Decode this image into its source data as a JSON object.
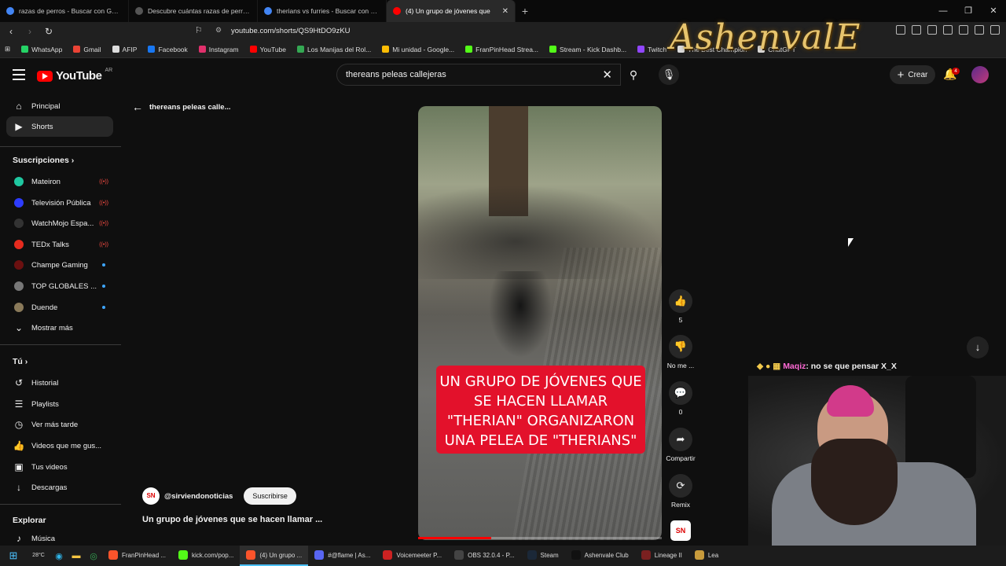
{
  "browser": {
    "tabs": [
      {
        "title": "razas de perros - Buscar con Google",
        "color": "#4285f4"
      },
      {
        "title": "Descubre cuántas razas de perros ex",
        "color": "#333333"
      },
      {
        "title": "therians vs furries - Buscar con Goog",
        "color": "#4285f4"
      },
      {
        "title": "(4) Un grupo de jóvenes que",
        "color": "#ff0000"
      }
    ],
    "active_tab_index": 3,
    "url": "youtube.com/shorts/QS9HtDO9zKU",
    "bookmarks": [
      {
        "label": "WhatsApp",
        "color": "#25d366"
      },
      {
        "label": "Gmail",
        "color": "#ea4335"
      },
      {
        "label": "AFIP",
        "color": "#dddddd"
      },
      {
        "label": "Facebook",
        "color": "#1877f2"
      },
      {
        "label": "Instagram",
        "color": "#e1306c"
      },
      {
        "label": "YouTube",
        "color": "#ff0000"
      },
      {
        "label": "Los Manijas del Rol...",
        "color": "#34a853"
      },
      {
        "label": "Mi unidad - Google...",
        "color": "#fbbc04"
      },
      {
        "label": "FranPinHead Strea...",
        "color": "#53fc18"
      },
      {
        "label": "Stream - Kick Dashb...",
        "color": "#53fc18"
      },
      {
        "label": "Twitch",
        "color": "#9146ff"
      },
      {
        "label": "The Best Champion",
        "color": "#dddddd"
      },
      {
        "label": "ChatGPT",
        "color": "#dddddd"
      }
    ]
  },
  "overlay": {
    "logo_text": "AshenvalE",
    "chat": {
      "badges": "◆ ● ▦",
      "user": "Maqiz",
      "message": ": no se que pensar X_X"
    }
  },
  "youtube": {
    "logo": "YouTube",
    "region": "AR",
    "search_value": "thereans peleas callejeras",
    "create_label": "Crear",
    "notifications": "4",
    "sidebar": {
      "main": [
        {
          "label": "Principal",
          "icon": "⌂"
        },
        {
          "label": "Shorts",
          "icon": "▶"
        }
      ],
      "subs_heading": "Suscripciones",
      "subs": [
        {
          "label": "Mateiron",
          "color": "#1fc7a0",
          "status": "live"
        },
        {
          "label": "Televisión Pública",
          "color": "#2d3cff",
          "status": "live"
        },
        {
          "label": "WatchMojo Espa...",
          "color": "#222222",
          "status": "live"
        },
        {
          "label": "TEDx Talks",
          "color": "#e62b1e",
          "status": "live"
        },
        {
          "label": "Champe Gaming",
          "color": "#6b1010",
          "status": "new"
        },
        {
          "label": "TOP GLOBALES ...",
          "color": "#777777",
          "status": "new"
        },
        {
          "label": "Duende",
          "color": "#8a7a5a",
          "status": "new"
        }
      ],
      "show_more": "Mostrar más",
      "you_heading": "Tú",
      "you": [
        {
          "label": "Historial",
          "icon": "↺"
        },
        {
          "label": "Playlists",
          "icon": "☰"
        },
        {
          "label": "Ver más tarde",
          "icon": "◷"
        },
        {
          "label": "Videos que me gus...",
          "icon": "👍"
        },
        {
          "label": "Tus videos",
          "icon": "▣"
        },
        {
          "label": "Descargas",
          "icon": "↓"
        }
      ],
      "explore_heading": "Explorar",
      "explore": [
        {
          "label": "Música",
          "icon": "♪"
        }
      ]
    },
    "short": {
      "back_label": "thereans peleas calle...",
      "caption": "UN GRUPO DE JÓVENES QUE SE HACEN LLAMAR \"THERIAN\" ORGANIZARON UNA PELEA DE \"THERIANS\"",
      "channel_logo": "SN",
      "channel": "@sirviendonoticias",
      "subscribe": "Suscribirse",
      "title": "Un grupo de jóvenes que se hacen llamar ...",
      "progress": 0.3,
      "likes": "5",
      "dislike_label": "No me ...",
      "comments": "0",
      "share_label": "Compartir",
      "remix_label": "Remix"
    }
  },
  "taskbar": {
    "weather": "28°C",
    "apps": [
      {
        "label": "FranPinHead ...",
        "color": "#fb542b",
        "active": false
      },
      {
        "label": "kick.com/pop...",
        "color": "#53fc18",
        "active": false
      },
      {
        "label": "(4) Un grupo ...",
        "color": "#fb542b",
        "active": true
      },
      {
        "label": "#@flame | As...",
        "color": "#5865f2",
        "active": false
      },
      {
        "label": "Voicemeeter P...",
        "color": "#cc2222",
        "active": false
      },
      {
        "label": "OBS 32.0.4 - P...",
        "color": "#444444",
        "active": false
      },
      {
        "label": "Steam",
        "color": "#1b2838",
        "active": false
      },
      {
        "label": "Ashenvale Club",
        "color": "#111111",
        "active": false
      },
      {
        "label": "Lineage II",
        "color": "#7a2020",
        "active": false
      },
      {
        "label": "Lea",
        "color": "#c89b3c",
        "active": false
      }
    ]
  }
}
